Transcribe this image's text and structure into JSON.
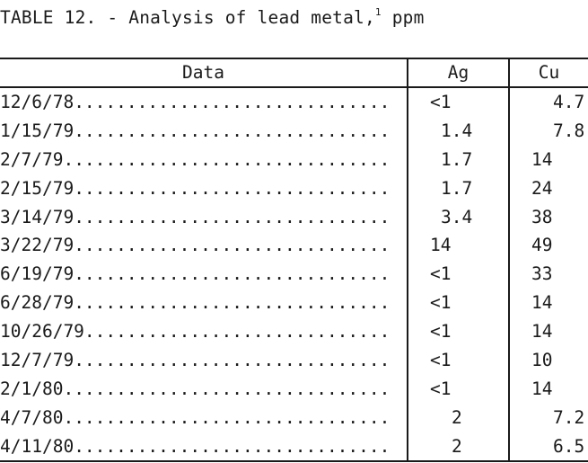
{
  "table": {
    "title": "TABLE 12. - Analysis of lead metal,",
    "footnote_marker": "1",
    "units": "ppm",
    "headers": {
      "date": "Data",
      "ag": "Ag",
      "cu": "Cu"
    },
    "rows": [
      {
        "date": "12/6/78",
        "ag": "<1",
        "cu": "4.7"
      },
      {
        "date": "1/15/79",
        "ag": "1.4",
        "cu": "7.8"
      },
      {
        "date": "2/7/79",
        "ag": "1.7",
        "cu": "14"
      },
      {
        "date": "2/15/79",
        "ag": "1.7",
        "cu": "24"
      },
      {
        "date": "3/14/79",
        "ag": "3.4",
        "cu": "38"
      },
      {
        "date": "3/22/79",
        "ag": "14",
        "cu": "49"
      },
      {
        "date": "6/19/79",
        "ag": "<1",
        "cu": "33"
      },
      {
        "date": "6/28/79",
        "ag": "<1",
        "cu": "14"
      },
      {
        "date": "10/26/79",
        "ag": "<1",
        "cu": "14"
      },
      {
        "date": "12/7/79",
        "ag": "<1",
        "cu": "10"
      },
      {
        "date": "2/1/80",
        "ag": "<1",
        "cu": "14"
      },
      {
        "date": "4/7/80",
        "ag": "2",
        "cu": "7.2"
      },
      {
        "date": "4/11/80",
        "ag": "2",
        "cu": "6.5"
      }
    ]
  }
}
